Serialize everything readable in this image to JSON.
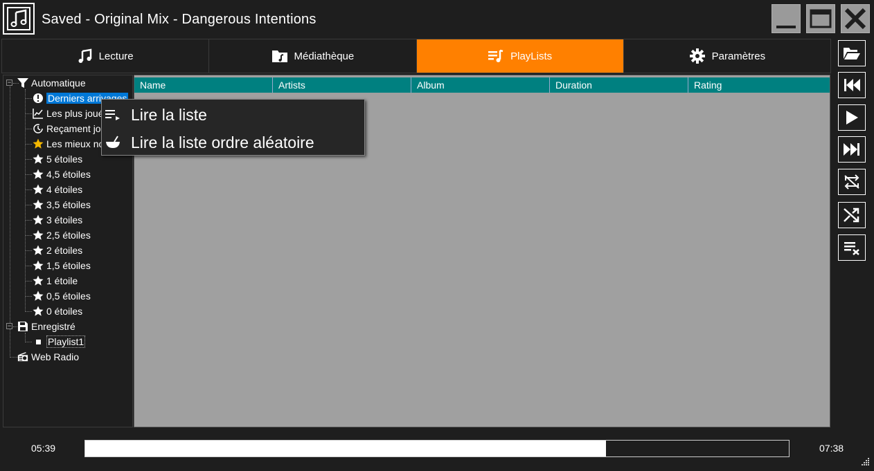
{
  "window": {
    "title": "Saved - Original Mix - Dangerous Intentions",
    "app_icon": "music-note-icon",
    "controls": [
      "minimize-icon",
      "maximize-icon",
      "close-icon"
    ]
  },
  "tabs": [
    {
      "label": "Lecture",
      "icon": "music-note-icon",
      "active": false
    },
    {
      "label": "Médiathèque",
      "icon": "folder-music-icon",
      "active": false
    },
    {
      "label": "PlayLists",
      "icon": "playlist-icon",
      "active": true
    },
    {
      "label": "Paramètres",
      "icon": "gear-icon",
      "active": false
    }
  ],
  "tree": {
    "automatic": {
      "label": "Automatique",
      "children": [
        {
          "label": "Derniers arrivages",
          "icon": "new-badge-icon",
          "selected": true
        },
        {
          "label": "Les plus joués",
          "icon": "chart-icon"
        },
        {
          "label": "Reçament joués",
          "icon": "history-icon"
        },
        {
          "label": "Les mieux notés",
          "icon": "star-gold-icon"
        },
        {
          "label": "5 étoiles",
          "icon": "star-icon"
        },
        {
          "label": "4,5 étoiles",
          "icon": "star-icon"
        },
        {
          "label": "4 étoiles",
          "icon": "star-icon"
        },
        {
          "label": "3,5 étoiles",
          "icon": "star-icon"
        },
        {
          "label": "3 étoiles",
          "icon": "star-icon"
        },
        {
          "label": "2,5 étoiles",
          "icon": "star-icon"
        },
        {
          "label": "2 étoiles",
          "icon": "star-icon"
        },
        {
          "label": "1,5 étoiles",
          "icon": "star-icon"
        },
        {
          "label": "1 étoile",
          "icon": "star-icon"
        },
        {
          "label": "0,5 étoiles",
          "icon": "star-icon"
        },
        {
          "label": "0 étoiles",
          "icon": "star-icon"
        }
      ]
    },
    "saved": {
      "label": "Enregistré",
      "children": [
        {
          "label": "Playlist1",
          "icon": "square-icon"
        }
      ]
    },
    "radio": {
      "label": "Web Radio",
      "icon": "radio-icon"
    }
  },
  "grid": {
    "columns": [
      "Name",
      "Artists",
      "Album",
      "Duration",
      "Rating"
    ],
    "rows": []
  },
  "context_menu": [
    {
      "label": "Lire la liste",
      "icon": "play-list-icon"
    },
    {
      "label": "Lire la liste ordre aléatoire",
      "icon": "shuffle-bowl-icon"
    }
  ],
  "toolbar": [
    "open-folder-icon",
    "previous-icon",
    "play-icon",
    "next-icon",
    "repeat-off-icon",
    "shuffle-icon",
    "clear-playlist-icon"
  ],
  "player": {
    "elapsed": "05:39",
    "total": "07:38",
    "progress": 0.74
  },
  "colors": {
    "accent": "#ff8000",
    "header": "#008080",
    "selection": "#0078d7",
    "background": "#1e1e1e",
    "grid_bg": "#a0a0a0"
  }
}
